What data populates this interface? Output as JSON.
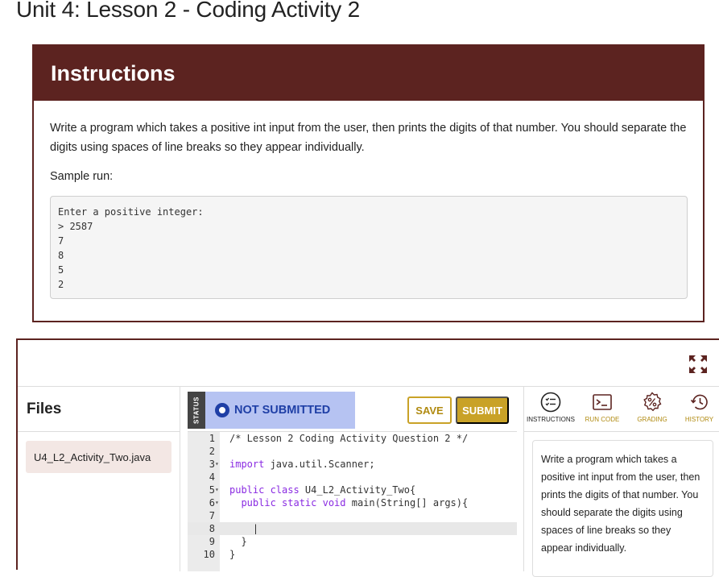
{
  "page": {
    "title": "Unit 4: Lesson 2 - Coding Activity 2"
  },
  "instructions": {
    "heading": "Instructions",
    "description": "Write a program which takes a positive int input from the user, then prints the digits of that number. You should separate the digits using spaces of line breaks so they appear individually.",
    "sample_label": "Sample run:",
    "sample_lines": [
      "Enter a positive integer:",
      "> 2587",
      "7",
      "8",
      "5",
      "2"
    ]
  },
  "files": {
    "title": "Files",
    "items": [
      "U4_L2_Activity_Two.java"
    ]
  },
  "editor": {
    "status_tab": "STATUS",
    "status": "NOT SUBMITTED",
    "save_label": "SAVE",
    "submit_label": "SUBMIT",
    "lines": [
      {
        "n": "1",
        "fold": "",
        "text": "/* Lesson 2 Coding Activity Question 2 */"
      },
      {
        "n": "2",
        "fold": "",
        "text": ""
      },
      {
        "n": "3",
        "fold": "▾",
        "text": "import java.util.Scanner;"
      },
      {
        "n": "4",
        "fold": "",
        "text": ""
      },
      {
        "n": "5",
        "fold": "▾",
        "text": "public class U4_L2_Activity_Two{"
      },
      {
        "n": "6",
        "fold": "▾",
        "text": "  public static void main(String[] args){"
      },
      {
        "n": "7",
        "fold": "",
        "text": ""
      },
      {
        "n": "8",
        "fold": "",
        "text": "    |"
      },
      {
        "n": "9",
        "fold": "",
        "text": "  }"
      },
      {
        "n": "10",
        "fold": "",
        "text": "}"
      }
    ]
  },
  "side": {
    "tabs": {
      "instructions": "INSTRUCTIONS",
      "run_code": "RUN CODE",
      "grading": "GRADING",
      "history": "HISTORY"
    },
    "text": "Write a program which takes a positive int input from the user, then prints the digits of that number. You should separate the digits using spaces of line breaks so they appear individually."
  },
  "colors": {
    "brand": "#5c2320",
    "accent": "#c9a227",
    "status_bg": "#b6c3f2",
    "status_fg": "#1f3fa6"
  }
}
